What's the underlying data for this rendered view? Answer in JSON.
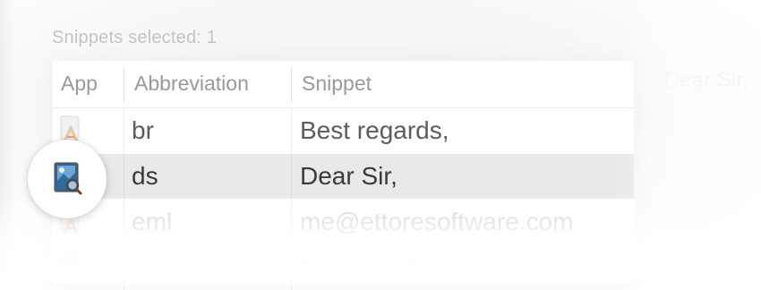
{
  "status": {
    "snippets_selected": "Snippets selected: 1"
  },
  "table": {
    "columns": {
      "app": "App",
      "abbreviation": "Abbreviation",
      "snippet": "Snippet"
    },
    "rows": [
      {
        "app_icon": "textedit-icon",
        "abbreviation": "br",
        "snippet": "Best regards,",
        "selected": false
      },
      {
        "app_icon": "preview-app-icon",
        "abbreviation": "ds",
        "snippet": "Dear Sir,",
        "selected": true
      },
      {
        "app_icon": "textedit-icon",
        "abbreviation": "eml",
        "snippet": "me@ettoresoftware.com",
        "selected": false
      },
      {
        "app_icon": "textedit-icon",
        "abbreviation": "esn",
        "snippet": "Ettore Software",
        "selected": false
      }
    ]
  },
  "preview": {
    "ghost_text": "Dear Sir,"
  },
  "colors": {
    "selected_row": "#e9e9e9",
    "header_text": "#9a9a9a",
    "row_text": "#5c5c5c"
  }
}
